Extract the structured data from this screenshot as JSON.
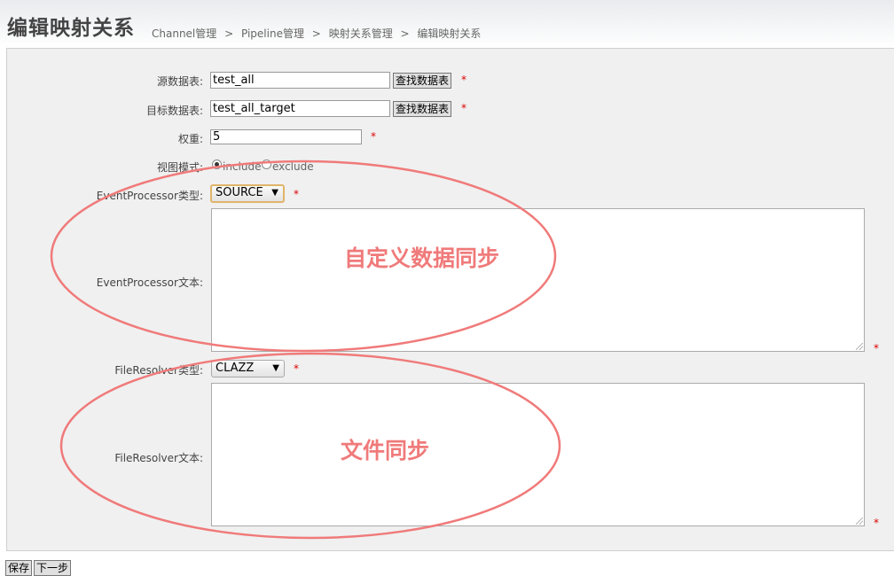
{
  "header": {
    "title": "编辑映射关系",
    "breadcrumb": [
      "Channel管理",
      ">",
      "Pipeline管理",
      ">",
      "映射关系管理",
      ">",
      "编辑映射关系"
    ]
  },
  "form": {
    "source_table": {
      "label": "源数据表:",
      "value": "test_all",
      "button": "查找数据表",
      "required": "*"
    },
    "target_table": {
      "label": "目标数据表:",
      "value": "test_all_target",
      "button": "查找数据表",
      "required": "*"
    },
    "weight": {
      "label": "权重:",
      "value": "5",
      "required": "*"
    },
    "view_mode": {
      "label": "视图模式:",
      "options": [
        "include",
        "exclude"
      ],
      "selected": "include"
    },
    "event_processor_type": {
      "label": "EventProcessor类型:",
      "value": "SOURCE",
      "required": "*"
    },
    "event_processor_text": {
      "label": "EventProcessor文本:",
      "value": "",
      "required": "*"
    },
    "file_resolver_type": {
      "label": "FileResolver类型:",
      "value": "CLAZZ",
      "required": "*"
    },
    "file_resolver_text": {
      "label": "FileResolver文本:",
      "value": "",
      "required": "*"
    }
  },
  "annotations": {
    "custom_sync": "自定义数据同步",
    "file_sync": "文件同步",
    "color": "#f07a7a"
  },
  "actions": {
    "save": "保存",
    "next": "下一步"
  }
}
